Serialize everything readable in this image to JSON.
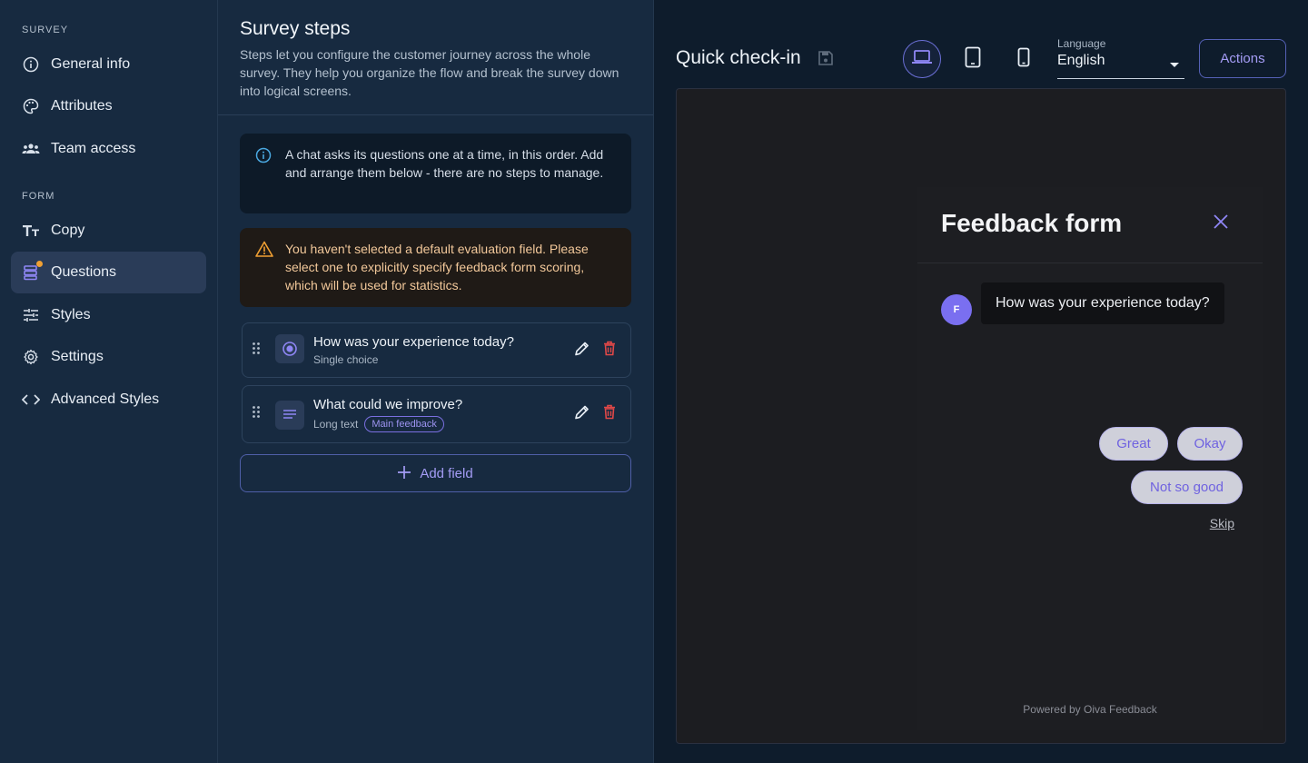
{
  "sidebar": {
    "survey_section": "SURVEY",
    "form_section": "FORM",
    "items": [
      {
        "label": "General info",
        "icon": "info-icon"
      },
      {
        "label": "Attributes",
        "icon": "palette-icon"
      },
      {
        "label": "Team access",
        "icon": "team-icon"
      },
      {
        "label": "Copy",
        "icon": "text-icon"
      },
      {
        "label": "Questions",
        "icon": "questions-icon",
        "active": true
      },
      {
        "label": "Styles",
        "icon": "sliders-icon"
      },
      {
        "label": "Settings",
        "icon": "gear-icon"
      },
      {
        "label": "Advanced Styles",
        "icon": "code-icon"
      }
    ]
  },
  "steps": {
    "title": "Survey steps",
    "description": "Steps let you configure the customer journey across the whole survey. They help you organize the flow and break the survey down into logical screens.",
    "info_message": "A chat asks its questions one at a time, in this order. Add and arrange them below - there are no steps to manage.",
    "warning_message": "You haven't selected a default evaluation field. Please select one to explicitly specify feedback form scoring, which will be used for statistics.",
    "questions": [
      {
        "title": "How was your experience today?",
        "type": "Single choice",
        "icon": "radio-icon"
      },
      {
        "title": "What could we improve?",
        "type": "Long text",
        "tag": "Main feedback",
        "icon": "long-text-icon"
      }
    ],
    "add_field_label": "Add field"
  },
  "toolbar": {
    "form_name": "Quick check-in",
    "language_label": "Language",
    "language_value": "English",
    "actions_label": "Actions",
    "devices": [
      "laptop-icon",
      "tablet-icon",
      "phone-icon"
    ]
  },
  "preview": {
    "widget_title": "Feedback form",
    "avatar_initial": "F",
    "question": "How was your experience today?",
    "choices": [
      "Great",
      "Okay",
      "Not so good"
    ],
    "skip_label": "Skip",
    "powered_by": "Powered by Oiva Feedback"
  },
  "colors": {
    "accent": "#7a6ff0",
    "warning": "#f0a033",
    "delete": "#e04848",
    "info": "#4aa8e0"
  }
}
